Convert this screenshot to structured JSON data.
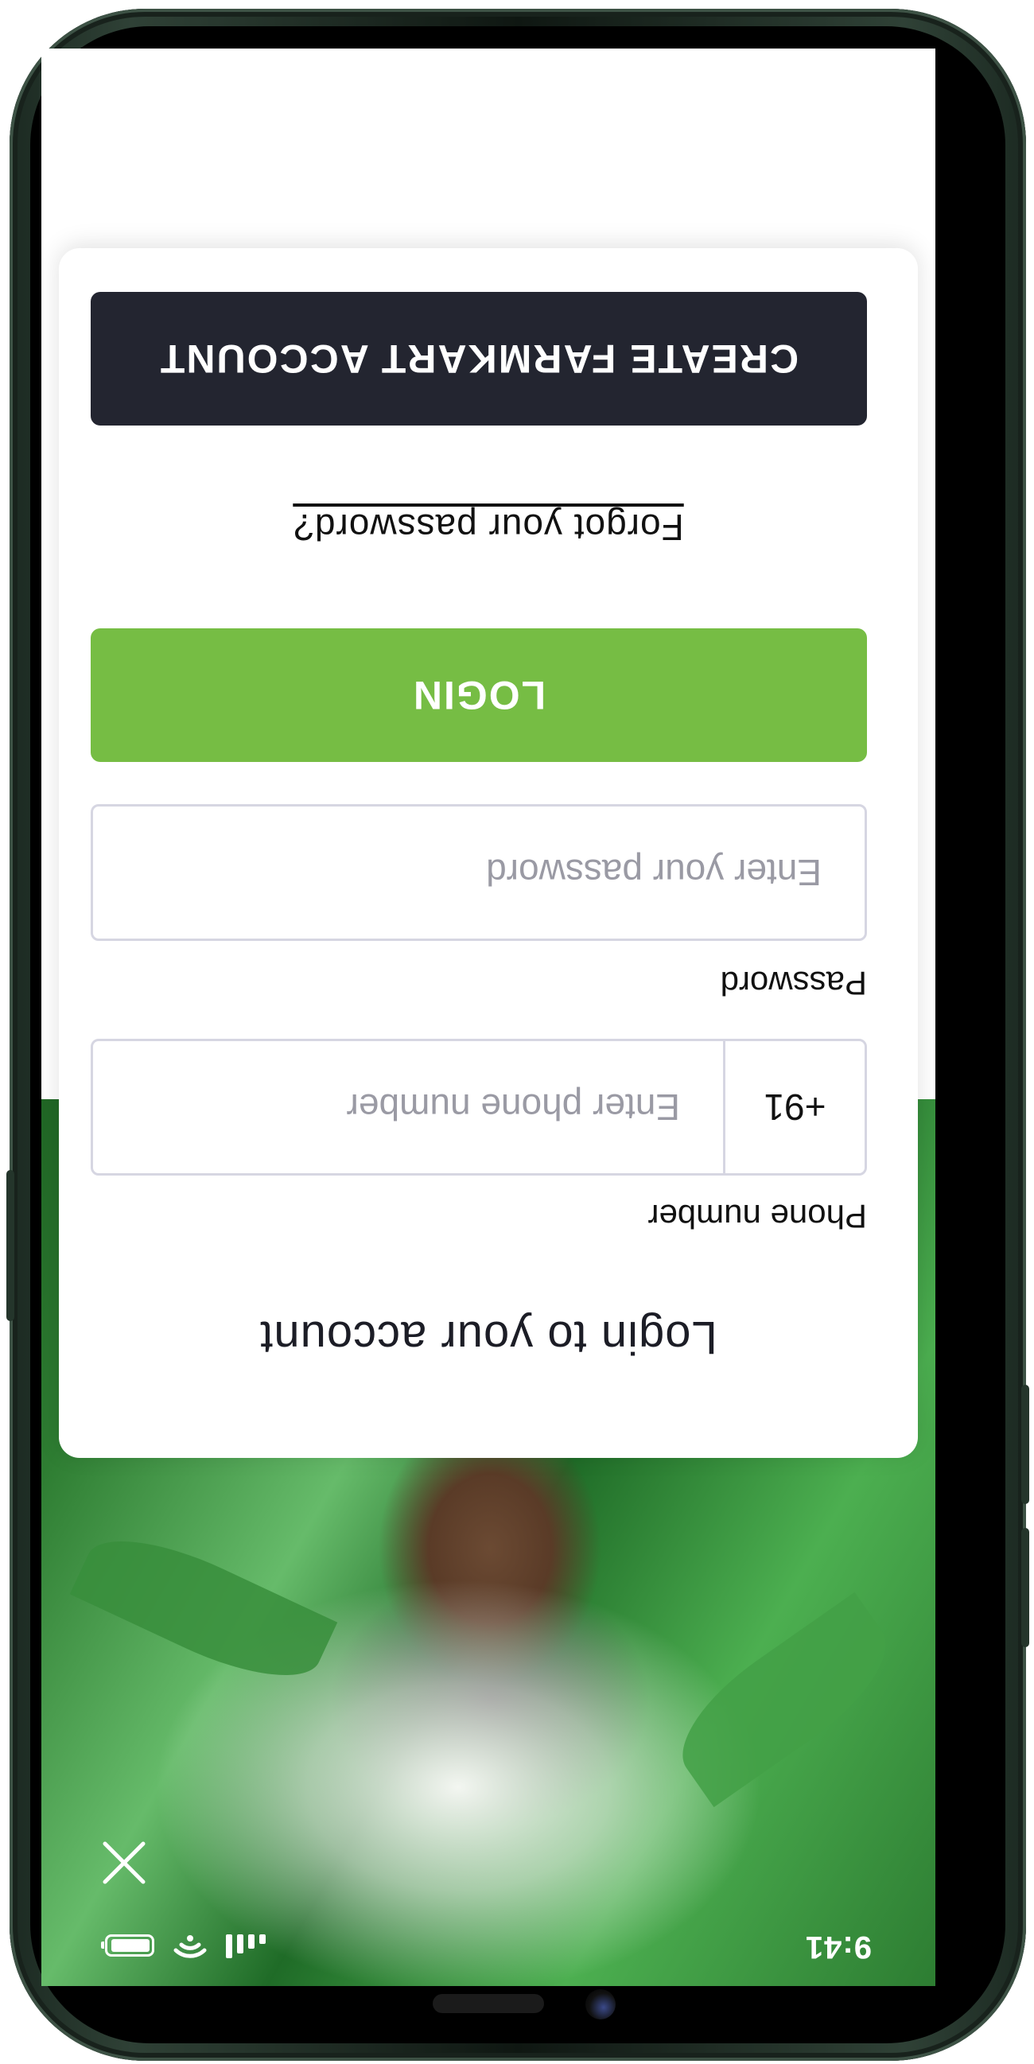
{
  "status_bar": {
    "time": "9:41",
    "icons": [
      "signal-icon",
      "wifi-icon",
      "battery-icon"
    ]
  },
  "hero": {
    "close_icon": "close-icon"
  },
  "login": {
    "title": "Login to your account",
    "phone": {
      "label": "Phone number",
      "prefix": "+91",
      "value": "",
      "placeholder": "Enter phone number"
    },
    "password": {
      "label": "Password",
      "value": "",
      "placeholder": "Enter your password"
    },
    "login_button": "LOGIN",
    "forgot_link": "Forgot your password?",
    "create_button": "CREATE FARMKART ACCOUNT"
  },
  "colors": {
    "login_button": "#76bd44",
    "create_button": "#232530",
    "input_border": "#d6d6e2"
  }
}
